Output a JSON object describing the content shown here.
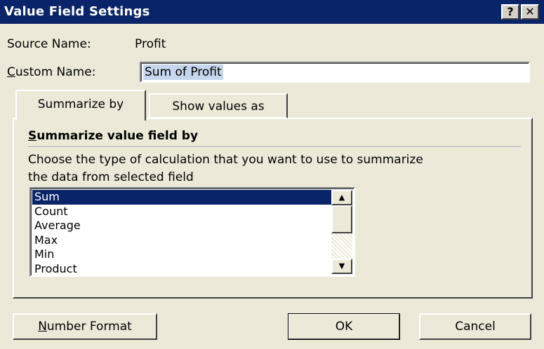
{
  "window": {
    "title": "Value Field Settings",
    "help_label": "?",
    "close_label": "✕"
  },
  "source": {
    "label": "Source Name:",
    "value": "Profit"
  },
  "custom_name": {
    "label_prefix": "",
    "label_mnemonic": "C",
    "label_rest": "ustom Name:",
    "value": "Sum of Profit"
  },
  "tabs": [
    {
      "label": "Summarize by",
      "active": true
    },
    {
      "label": "Show values as",
      "active": false
    }
  ],
  "panel": {
    "title_mnemonic": "S",
    "title_rest": "ummarize value field by",
    "description_line1": "Choose the type of calculation that you want to use to summarize",
    "description_line2": "the data from selected field"
  },
  "list": {
    "items": [
      "Sum",
      "Count",
      "Average",
      "Max",
      "Min",
      "Product"
    ],
    "selected": "Sum",
    "scroll_up_icon": "▲",
    "scroll_down_icon": "▼"
  },
  "buttons": {
    "number_format_mnemonic": "N",
    "number_format_rest": "umber Format",
    "ok": "OK",
    "cancel": "Cancel"
  },
  "colors": {
    "title_bar": "#0a246a",
    "selection": "#0a246a",
    "dialog_face": "#ece9d8"
  }
}
